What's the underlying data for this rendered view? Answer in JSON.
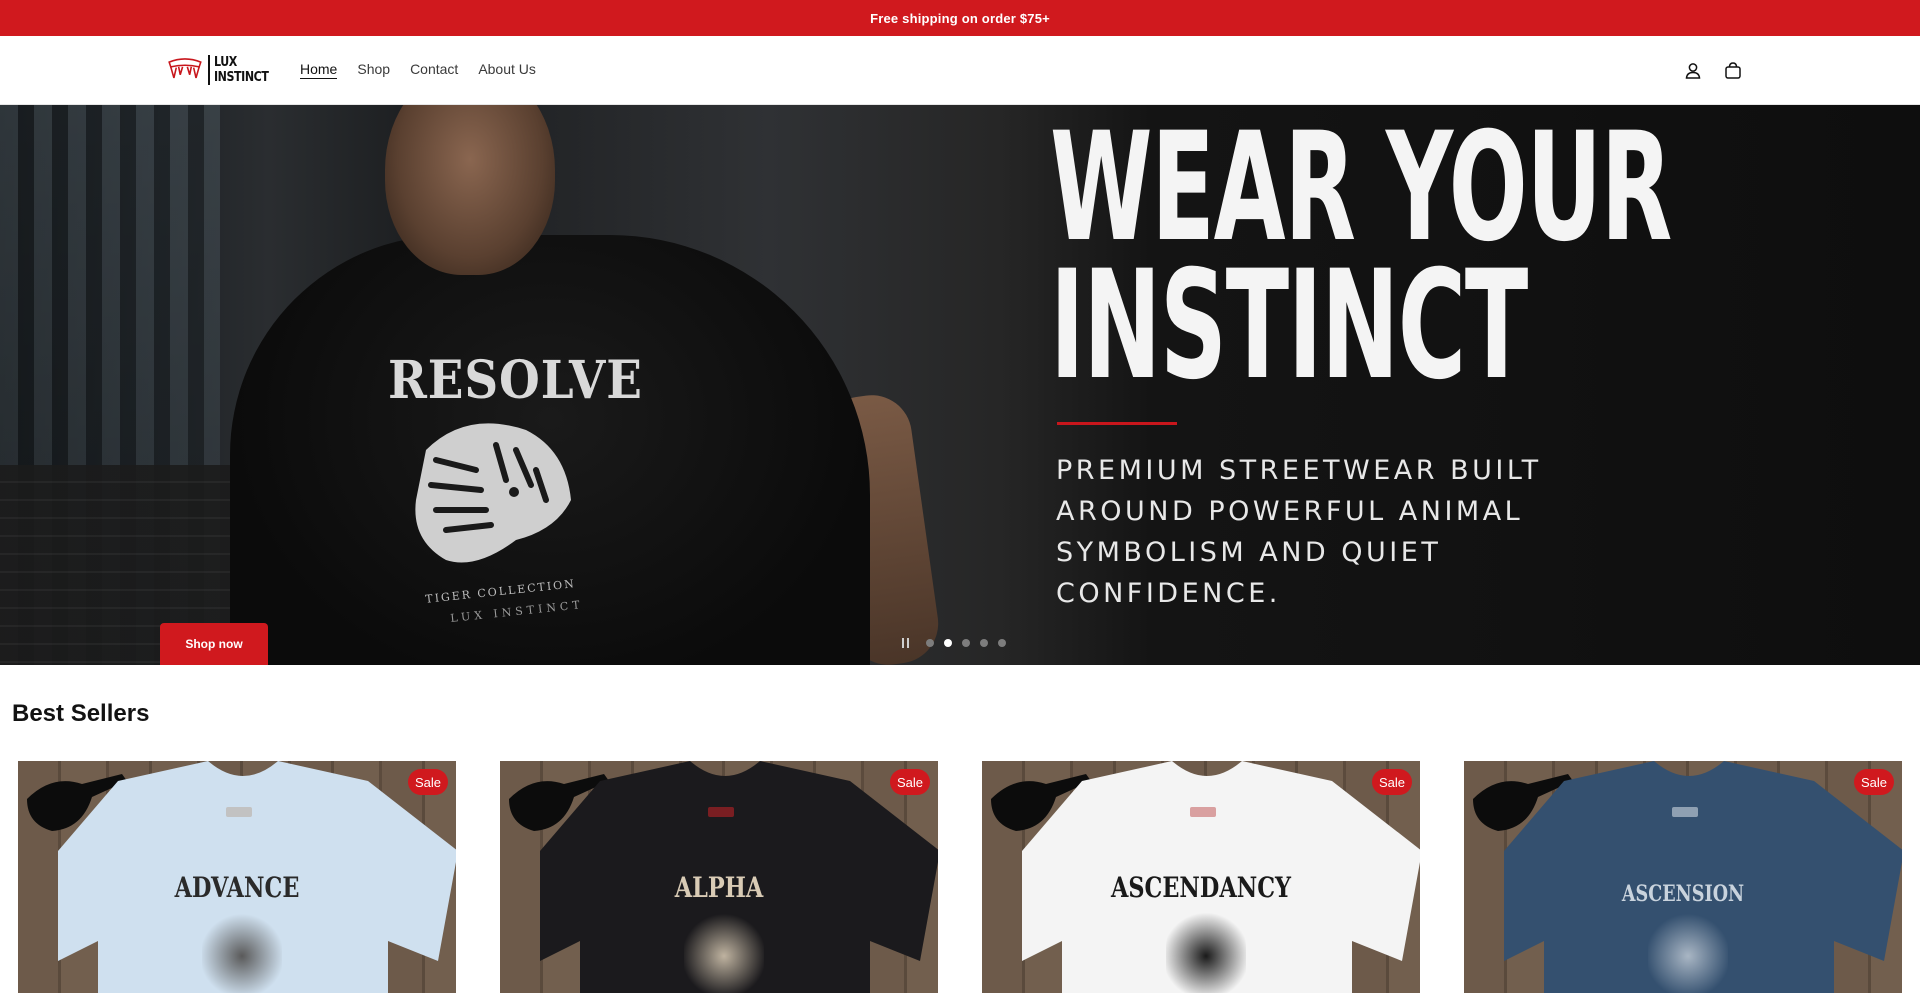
{
  "announcement": {
    "text": "Free shipping on order $75+"
  },
  "header": {
    "logo": {
      "line1": "LUX",
      "line2": "INSTINCT"
    },
    "nav": [
      {
        "label": "Home",
        "active": true
      },
      {
        "label": "Shop",
        "active": false
      },
      {
        "label": "Contact",
        "active": false
      },
      {
        "label": "About Us",
        "active": false
      }
    ],
    "icons": [
      "account-icon",
      "cart-icon"
    ]
  },
  "hero": {
    "title_line1": "WEAR YOUR",
    "title_line2": "INSTINCT",
    "subtitle": "PREMIUM STREETWEAR BUILT AROUND POWERFUL ANIMAL SYMBOLISM AND QUIET CONFIDENCE.",
    "shirt_print": "RESOLVE",
    "shirt_caption": "TIGER COLLECTION",
    "shirt_brand": "LUX INSTINCT",
    "cta_label": "Shop now",
    "slides": {
      "total": 5,
      "current": 2
    },
    "colors": {
      "accent": "#d0191e"
    }
  },
  "best_sellers": {
    "title": "Best Sellers",
    "products": [
      {
        "design": "ADVANCE",
        "shirt_color": "#cfe0ef",
        "ink": "#2a2a2a",
        "badge": "Sale"
      },
      {
        "design": "ALPHA",
        "shirt_color": "#1b1a1d",
        "ink": "#d9cbb5",
        "badge": "Sale"
      },
      {
        "design": "ASCENDANCY",
        "shirt_color": "#f4f4f4",
        "ink": "#1a1a1a",
        "badge": "Sale"
      },
      {
        "design": "ASCENSION",
        "shirt_color": "#34506f",
        "ink": "#c9d3dd",
        "badge": "Sale"
      }
    ]
  }
}
